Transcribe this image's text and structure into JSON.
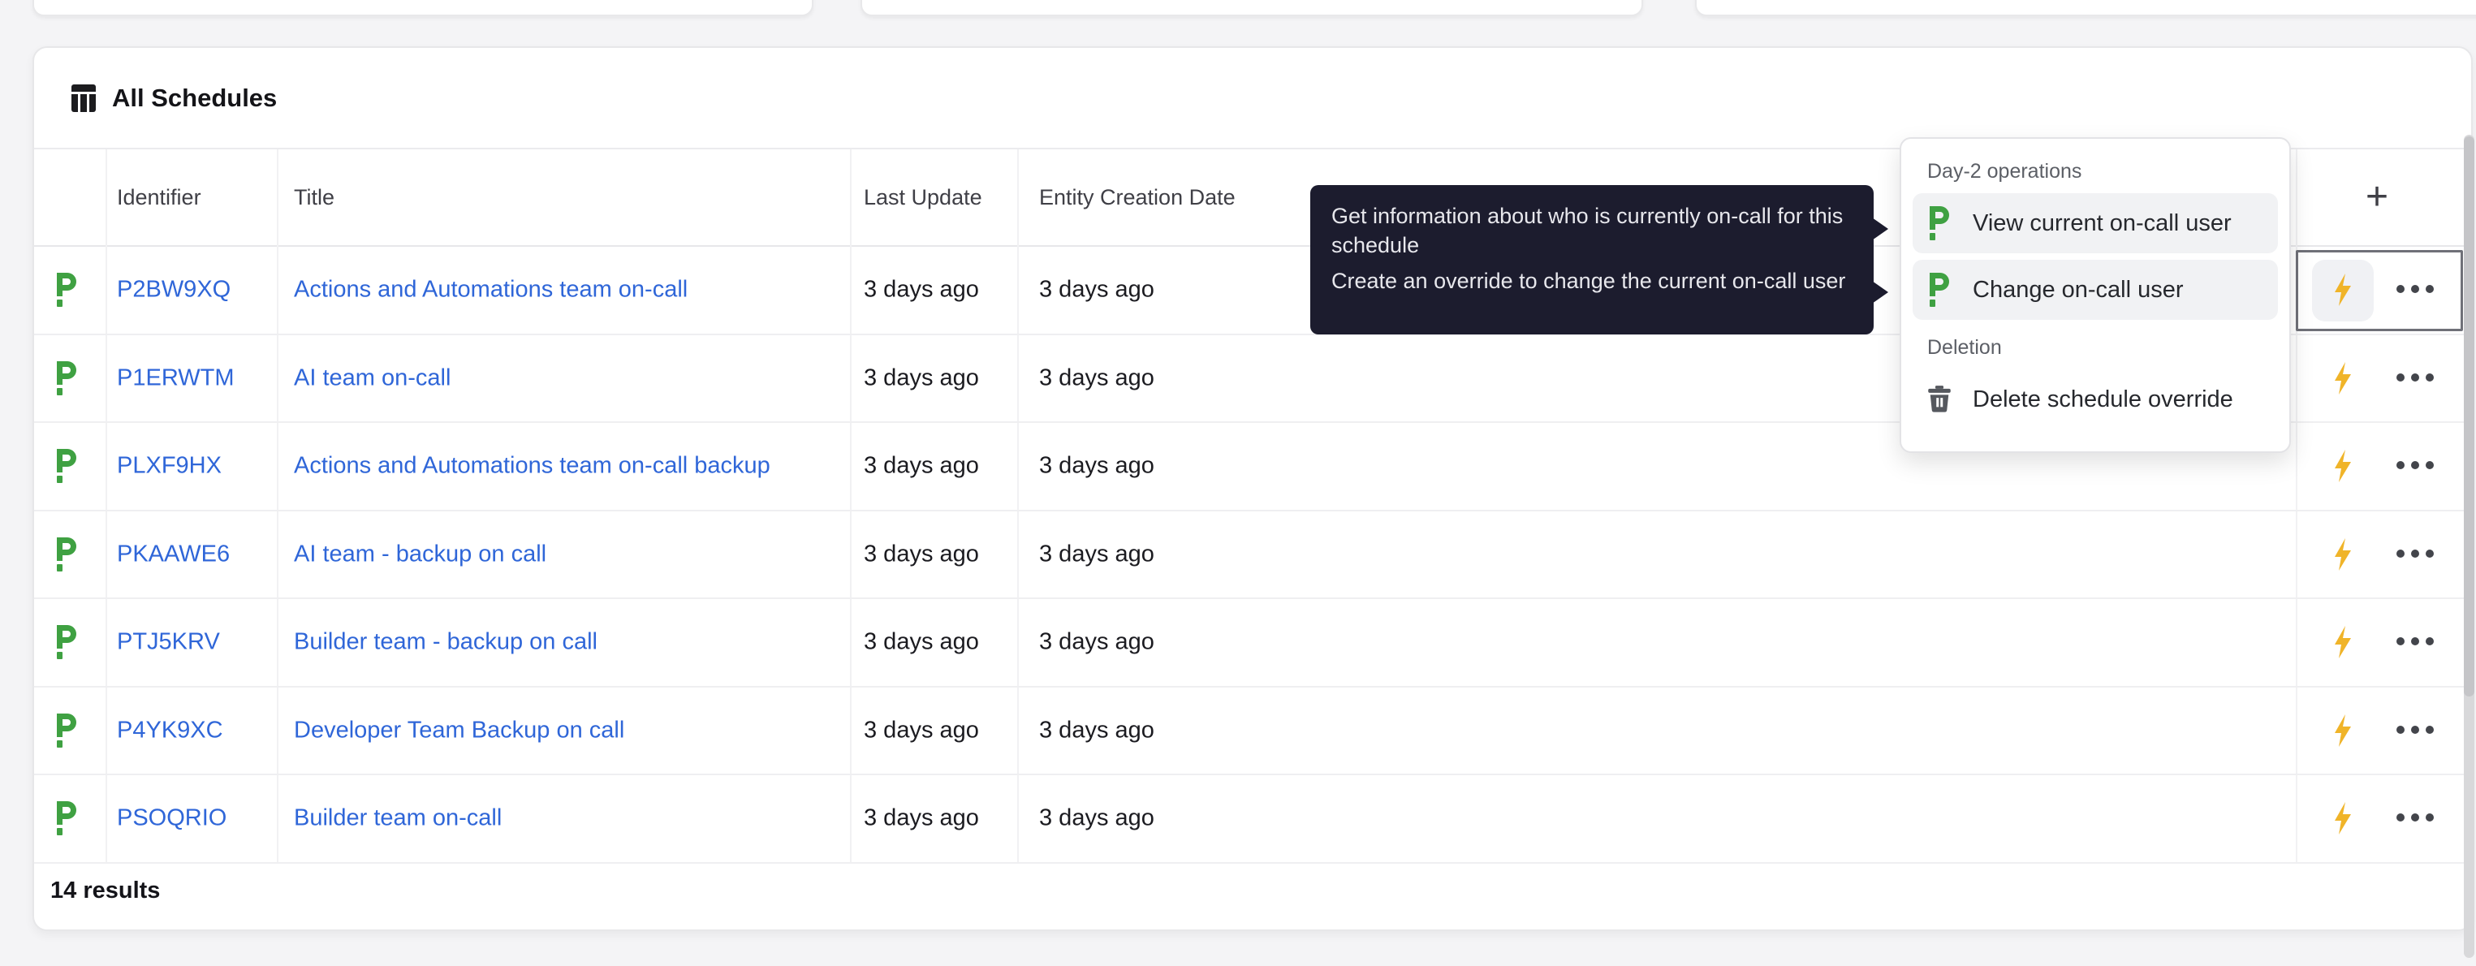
{
  "header": {
    "title": "All Schedules"
  },
  "toolbar": {
    "add_label": "+"
  },
  "table": {
    "columns": [
      "Identifier",
      "Title",
      "Last Update",
      "Entity Creation Date"
    ],
    "rows": [
      {
        "identifier": "P2BW9XQ",
        "title": "Actions and Automations team on-call",
        "last_update": "3 days ago",
        "created": "3 days ago"
      },
      {
        "identifier": "P1ERWTM",
        "title": "AI team on-call",
        "last_update": "3 days ago",
        "created": "3 days ago"
      },
      {
        "identifier": "PLXF9HX",
        "title": "Actions and Automations team on-call backup",
        "last_update": "3 days ago",
        "created": "3 days ago"
      },
      {
        "identifier": "PKAAWE6",
        "title": "AI team - backup on call",
        "last_update": "3 days ago",
        "created": "3 days ago"
      },
      {
        "identifier": "PTJ5KRV",
        "title": "Builder team - backup on call",
        "last_update": "3 days ago",
        "created": "3 days ago"
      },
      {
        "identifier": "P4YK9XC",
        "title": "Developer Team Backup on call",
        "last_update": "3 days ago",
        "created": "3 days ago"
      },
      {
        "identifier": "PSOQRIO",
        "title": "Builder team on-call",
        "last_update": "3 days ago",
        "created": "3 days ago"
      }
    ],
    "results_text": "14 results"
  },
  "tooltip": {
    "line1": "Get information about who is currently on-call for this schedule",
    "line2": "Create an override to change the current on-call user"
  },
  "menu": {
    "sections": [
      {
        "label": "Day-2 operations",
        "items": [
          "View current on-call user",
          "Change on-call user"
        ]
      },
      {
        "label": "Deletion",
        "items": [
          "Delete schedule override"
        ]
      }
    ]
  },
  "icons": {
    "card_icon": "table-columns-icon",
    "row_icon": "pagerduty-icon",
    "action_icon": "lightning-icon",
    "row_menu_icon": "ellipsis-icon",
    "delete_icon": "trash-icon"
  },
  "colors": {
    "link_blue": "#2f66d8",
    "pagerduty_green": "#3fa142",
    "bolt_yellow": "#f0b429",
    "tooltip_bg": "#1c1c2e",
    "page_bg": "#f4f4f6"
  }
}
